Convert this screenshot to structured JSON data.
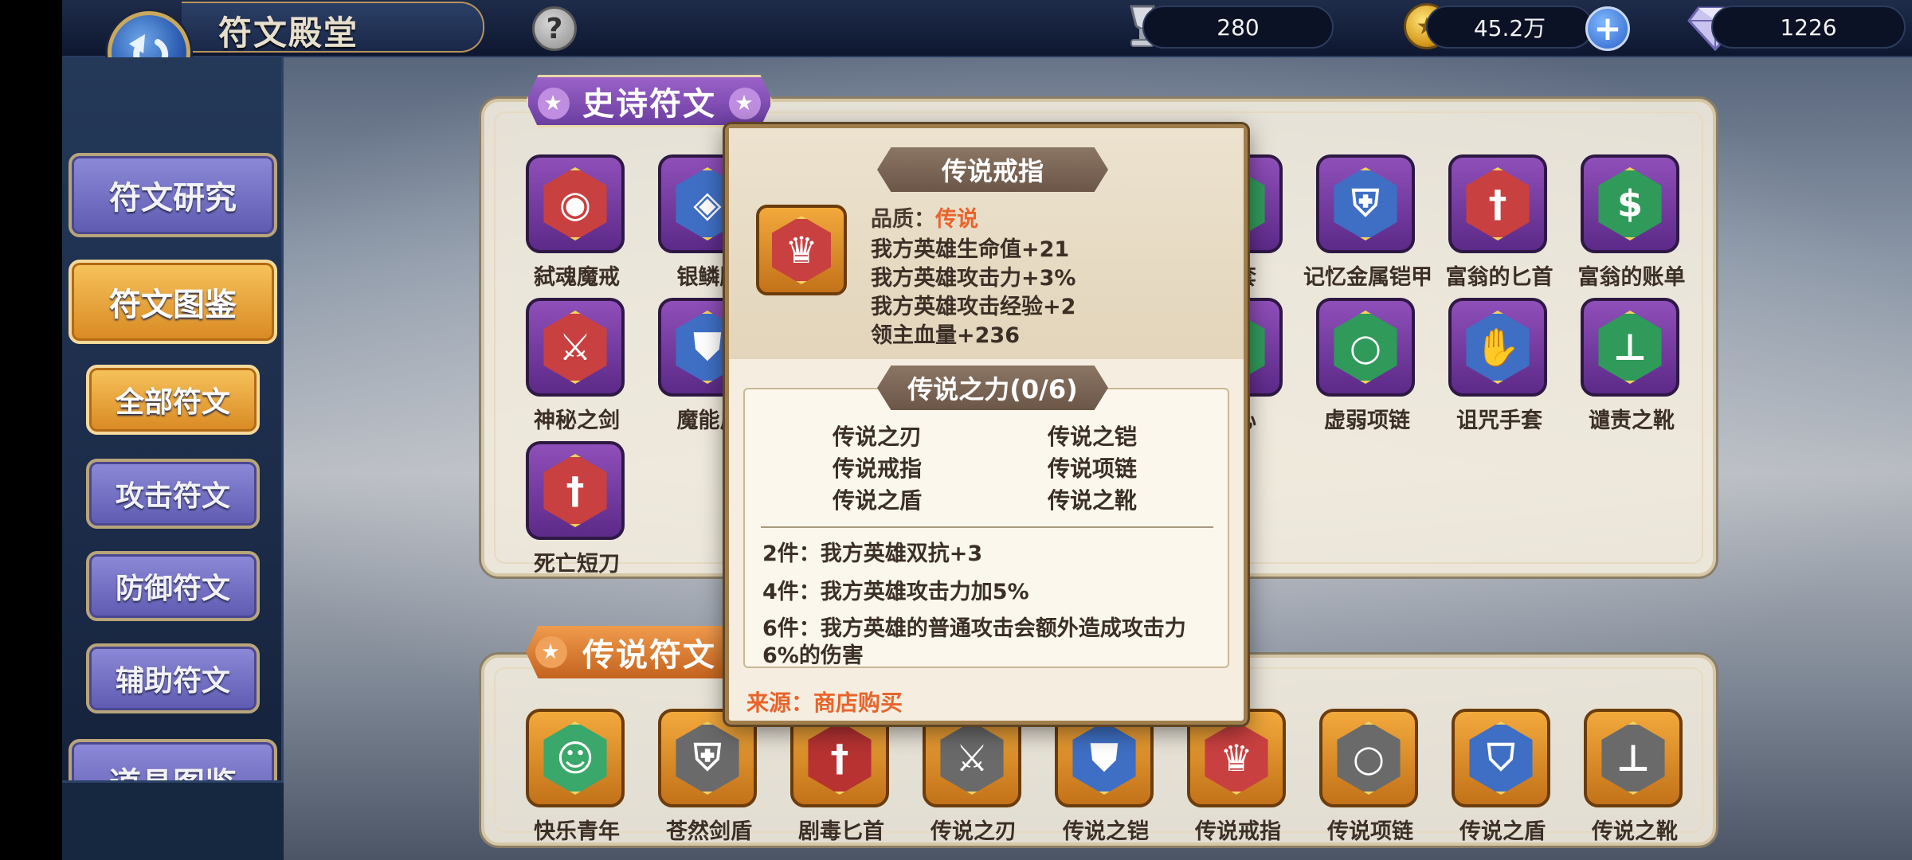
{
  "header": {
    "title": "符文殿堂",
    "help_label": "?",
    "resources": {
      "trophy": "280",
      "gold": "45.2万",
      "gold_plus": "+",
      "gems": "1226"
    }
  },
  "sidebar": {
    "items": [
      {
        "label": "符文研究",
        "style": "purple"
      },
      {
        "label": "符文图鉴",
        "style": "gold"
      },
      {
        "label": "全部符文",
        "style": "gold"
      },
      {
        "label": "攻击符文",
        "style": "purple"
      },
      {
        "label": "防御符文",
        "style": "purple"
      },
      {
        "label": "辅助符文",
        "style": "purple"
      },
      {
        "label": "道具图鉴",
        "style": "purple"
      }
    ]
  },
  "epic_section": {
    "title": "史诗符文",
    "runes": [
      "弑魂魔戒",
      "银鳞腕",
      "手套",
      "记忆金属铠甲",
      "富翁的匕首",
      "富翁的账单",
      "神秘之剑",
      "魔能盾",
      "之心",
      "虚弱项链",
      "诅咒手套",
      "谴责之靴",
      "死亡短刀"
    ]
  },
  "legend_section": {
    "title": "传说符文",
    "runes": [
      "快乐青年",
      "苍然剑盾",
      "剧毒匕首",
      "传说之刃",
      "传说之铠",
      "传说戒指",
      "传说项链",
      "传说之盾",
      "传说之靴"
    ]
  },
  "tooltip": {
    "name": "传说戒指",
    "quality_label": "品质：",
    "quality_value": "传说",
    "stats": [
      "我方英雄生命值+21",
      "我方英雄攻击力+3%",
      "我方英雄攻击经验+2",
      "领主血量+236"
    ],
    "set_title": "传说之力(0/6)",
    "set_pieces": [
      "传说之刃",
      "传说之铠",
      "传说戒指",
      "传说项链",
      "传说之盾",
      "传说之靴"
    ],
    "bonuses": [
      "2件：我方英雄双抗+3",
      "4件：我方英雄攻击力加5%",
      "6件：我方英雄的普通攻击会额外造成攻击力6%的伤害"
    ],
    "source": "来源：商店购买"
  },
  "colors": {
    "accent_orange": "#e8642c",
    "epic_purple": "#7a3fa8",
    "legend_orange": "#d9842a"
  }
}
